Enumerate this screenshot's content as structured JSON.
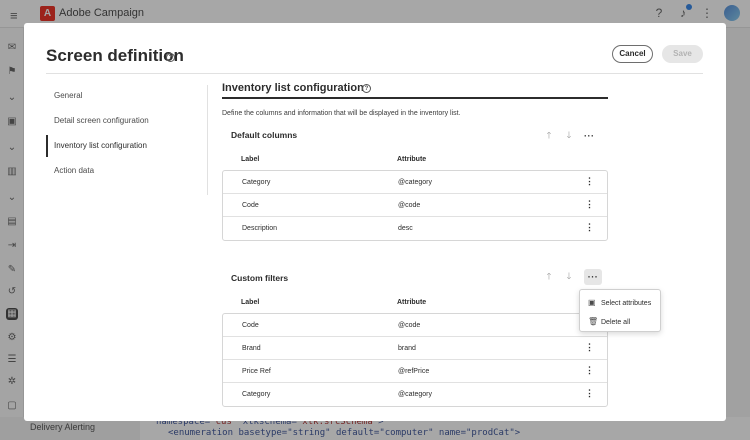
{
  "app": {
    "title": "Adobe Campaign",
    "logo_letter": "A",
    "hamburger_icon": "≡"
  },
  "background": {
    "footer_item": "Delivery Alerting",
    "code_line1_a": "namespace=",
    "code_line1_b": "\"cus\"",
    "code_line1_c": " xtkschema=",
    "code_line1_d": "\"xtk:srcSchema\"",
    "code_line1_e": ">",
    "code_line2": "<enumeration basetype=\"string\" default=\"computer\" name=\"prodCat\">"
  },
  "modal": {
    "title": "Screen definition",
    "cancel_label": "Cancel",
    "save_label": "Save",
    "nav": [
      {
        "label": "General"
      },
      {
        "label": "Detail screen configuration"
      },
      {
        "label": "Inventory list configuration",
        "selected": true
      },
      {
        "label": "Action data"
      }
    ],
    "panel": {
      "title": "Inventory list configuration",
      "description": "Define the columns and information that will be displayed in the inventory list.",
      "default_columns": {
        "title": "Default columns",
        "col_label": "Label",
        "col_attribute": "Attribute",
        "rows": [
          {
            "label": "Category",
            "attribute": "@category"
          },
          {
            "label": "Code",
            "attribute": "@code"
          },
          {
            "label": "Description",
            "attribute": "desc"
          }
        ]
      },
      "custom_filters": {
        "title": "Custom filters",
        "col_label": "Label",
        "col_attribute": "Attribute",
        "rows": [
          {
            "label": "Code",
            "attribute": "@code"
          },
          {
            "label": "Brand",
            "attribute": "brand"
          },
          {
            "label": "Price Ref",
            "attribute": "@refPrice"
          },
          {
            "label": "Category",
            "attribute": "@category"
          }
        ]
      }
    },
    "popover": {
      "select_attributes": "Select attributes",
      "delete_all": "Delete all"
    }
  },
  "icons": {
    "help": "?",
    "move_up": "🡑",
    "move_down": "🡓",
    "more": "···",
    "kebab": "⋮"
  },
  "colors": {
    "brand": "#eb1000",
    "accent": "#1473e6"
  }
}
